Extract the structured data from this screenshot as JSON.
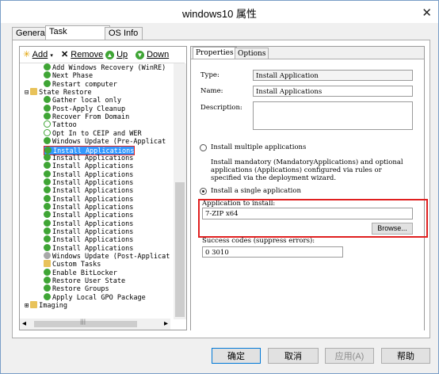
{
  "window": {
    "title": "windows10 属性",
    "close": "✕"
  },
  "tabs": [
    "General",
    "Task Sequence",
    "OS Info"
  ],
  "toolbar": {
    "add": "Add",
    "remove": "Remove",
    "up": "Up",
    "down": "Down"
  },
  "tree": [
    {
      "label": "Add Windows Recovery (WinRE)",
      "icon": "green-check-icon",
      "indent": 2
    },
    {
      "label": "Next Phase",
      "icon": "green-check-icon",
      "indent": 2
    },
    {
      "label": "Restart computer",
      "icon": "green-check-icon",
      "indent": 2
    },
    {
      "label": "State Restore",
      "icon": "folder-icon",
      "indent": 1,
      "expander": "⊟"
    },
    {
      "label": "Gather local only",
      "icon": "green-check-icon",
      "indent": 2
    },
    {
      "label": "Post-Apply Cleanup",
      "icon": "green-check-icon",
      "indent": 2
    },
    {
      "label": "Recover From Domain",
      "icon": "green-check-icon",
      "indent": 2
    },
    {
      "label": "Tattoo",
      "icon": "clock-check-icon",
      "indent": 2
    },
    {
      "label": "Opt In to CEIP and WER",
      "icon": "clock-check-icon",
      "indent": 2
    },
    {
      "label": "Windows Update (Pre-Applicat",
      "icon": "green-check-icon",
      "indent": 2
    },
    {
      "label": "Install Applications",
      "icon": "green-check-icon",
      "indent": 2,
      "selected": true
    },
    {
      "label": "Install Applications",
      "icon": "green-check-icon",
      "indent": 2
    },
    {
      "label": "Install Applications",
      "icon": "green-check-icon",
      "indent": 2
    },
    {
      "label": "Install Applications",
      "icon": "green-check-icon",
      "indent": 2
    },
    {
      "label": "Install Applications",
      "icon": "green-check-icon",
      "indent": 2
    },
    {
      "label": "Install Applications",
      "icon": "green-check-icon",
      "indent": 2
    },
    {
      "label": "Install Applications",
      "icon": "green-check-icon",
      "indent": 2
    },
    {
      "label": "Install Applications",
      "icon": "green-check-icon",
      "indent": 2
    },
    {
      "label": "Install Applications",
      "icon": "green-check-icon",
      "indent": 2
    },
    {
      "label": "Install Applications",
      "icon": "green-check-icon",
      "indent": 2
    },
    {
      "label": "Install Applications",
      "icon": "green-check-icon",
      "indent": 2
    },
    {
      "label": "Install Applications",
      "icon": "green-check-icon",
      "indent": 2
    },
    {
      "label": "Install Applications",
      "icon": "green-check-icon",
      "indent": 2
    },
    {
      "label": "Windows Update (Post-Applicati",
      "icon": "gray-gear-icon",
      "indent": 2
    },
    {
      "label": "Custom Tasks",
      "icon": "folder-icon",
      "indent": 2
    },
    {
      "label": "Enable BitLocker",
      "icon": "green-check-icon",
      "indent": 2
    },
    {
      "label": "Restore User State",
      "icon": "green-check-icon",
      "indent": 2
    },
    {
      "label": "Restore Groups",
      "icon": "green-check-icon",
      "indent": 2
    },
    {
      "label": "Apply Local GPO Package",
      "icon": "green-check-icon",
      "indent": 2
    },
    {
      "label": "Imaging",
      "icon": "folder-icon",
      "indent": 1,
      "expander": "⊞"
    }
  ],
  "scrollbar": {
    "left_arrow": "◂",
    "right_arrow": "▸",
    "grip": "|||"
  },
  "right_tabs": [
    "Properties",
    "Options"
  ],
  "properties": {
    "type_label": "Type:",
    "type_value": "Install Application",
    "name_label": "Name:",
    "name_value": "Install Applications",
    "description_label": "Description:",
    "description_value": "",
    "radio_multiple": "Install multiple applications",
    "multiple_help": "Install mandatory (MandatoryApplications) and optional applications (Applications) configured via rules or specified via the deployment wizard.",
    "radio_single": "Install a single application",
    "app_label": "Application to install:",
    "app_value": "7-ZIP x64",
    "browse": "Browse...",
    "success_label": "Success codes (suppress errors):",
    "success_value": "0 3010"
  },
  "buttons": {
    "ok": "确定",
    "cancel": "取消",
    "apply": "应用(A)",
    "help": "帮助"
  }
}
